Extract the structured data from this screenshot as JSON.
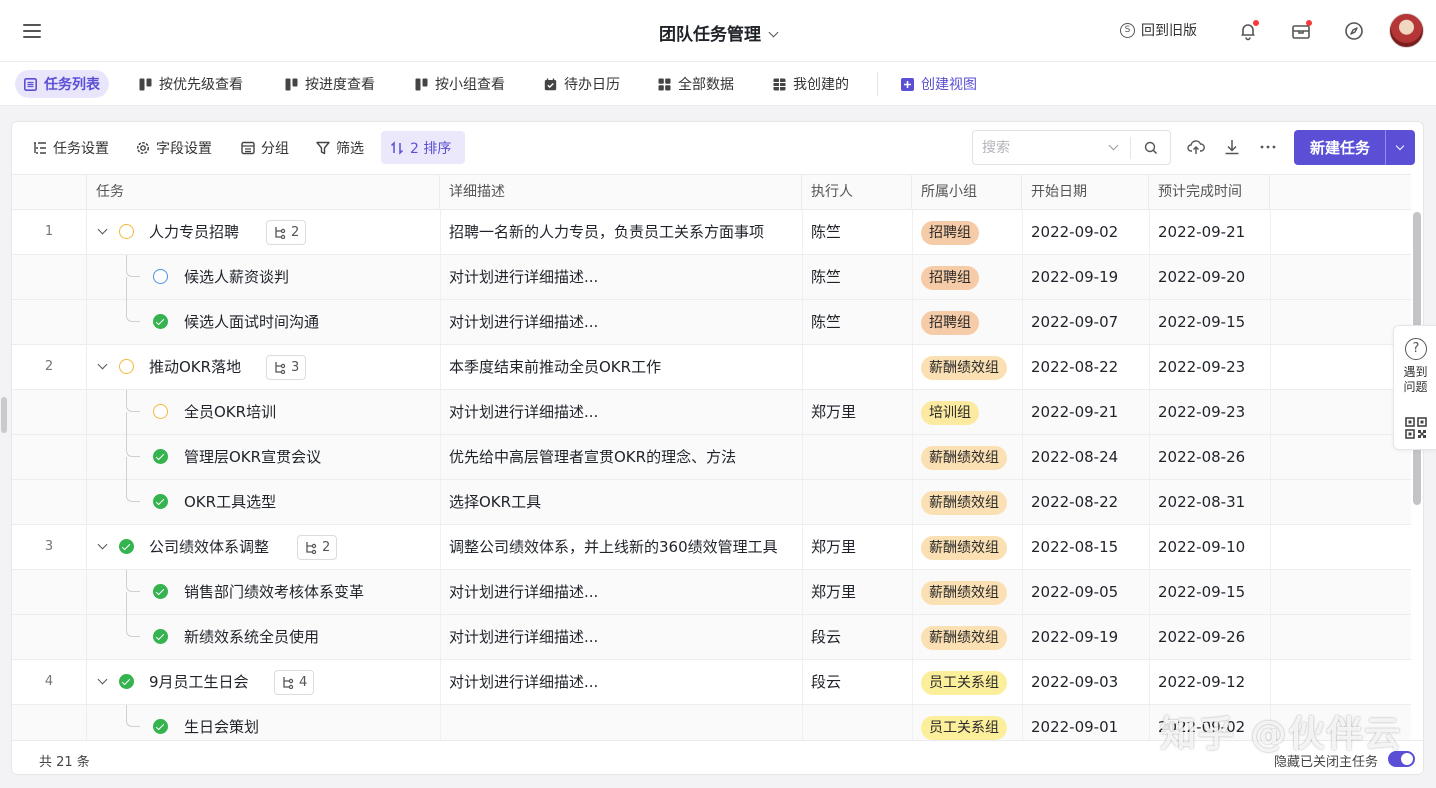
{
  "header": {
    "title": "团队任务管理",
    "back_old": "回到旧版"
  },
  "views": [
    {
      "label": "任务列表"
    },
    {
      "label": "按优先级查看"
    },
    {
      "label": "按进度查看"
    },
    {
      "label": "按小组查看"
    },
    {
      "label": "待办日历"
    },
    {
      "label": "全部数据"
    },
    {
      "label": "我创建的"
    },
    {
      "label": "创建视图"
    }
  ],
  "toolbar": {
    "task_settings": "任务设置",
    "field_settings": "字段设置",
    "group": "分组",
    "filter": "筛选",
    "sort": "2 排序",
    "search_placeholder": "搜索",
    "new_task": "新建任务"
  },
  "columns": [
    "任务",
    "详细描述",
    "执行人",
    "所属小组",
    "开始日期",
    "预计完成时间"
  ],
  "rows": [
    {
      "num": "1",
      "name": "人力专员招聘",
      "sub": "2",
      "desc": "招聘一名新的人力专员，负责员工关系方面事项",
      "owner": "陈竺",
      "group": "招聘组",
      "start": "2022-09-02",
      "end": "2022-09-21"
    },
    {
      "name": "候选人薪资谈判",
      "desc": "对计划进行详细描述...",
      "owner": "陈竺",
      "group": "招聘组",
      "start": "2022-09-19",
      "end": "2022-09-20"
    },
    {
      "name": "候选人面试时间沟通",
      "desc": "对计划进行详细描述...",
      "owner": "陈竺",
      "group": "招聘组",
      "start": "2022-09-07",
      "end": "2022-09-15"
    },
    {
      "num": "2",
      "name": "推动OKR落地",
      "sub": "3",
      "desc": "本季度结束前推动全员OKR工作",
      "owner": "",
      "group": "薪酬绩效组",
      "start": "2022-08-22",
      "end": "2022-09-23"
    },
    {
      "name": "全员OKR培训",
      "desc": "对计划进行详细描述...",
      "owner": "郑万里",
      "group": "培训组",
      "start": "2022-09-21",
      "end": "2022-09-23"
    },
    {
      "name": "管理层OKR宣贯会议",
      "desc": "优先给中高层管理者宣贯OKR的理念、方法",
      "owner": "",
      "group": "薪酬绩效组",
      "start": "2022-08-24",
      "end": "2022-08-26"
    },
    {
      "name": "OKR工具选型",
      "desc": "选择OKR工具",
      "owner": "",
      "group": "薪酬绩效组",
      "start": "2022-08-22",
      "end": "2022-08-31"
    },
    {
      "num": "3",
      "name": "公司绩效体系调整",
      "sub": "2",
      "desc": "调整公司绩效体系，并上线新的360绩效管理工具",
      "owner": "郑万里",
      "group": "薪酬绩效组",
      "start": "2022-08-15",
      "end": "2022-09-10"
    },
    {
      "name": "销售部门绩效考核体系变革",
      "desc": "对计划进行详细描述...",
      "owner": "郑万里",
      "group": "薪酬绩效组",
      "start": "2022-09-05",
      "end": "2022-09-15"
    },
    {
      "name": "新绩效系统全员使用",
      "desc": "对计划进行详细描述...",
      "owner": "段云",
      "group": "薪酬绩效组",
      "start": "2022-09-19",
      "end": "2022-09-26"
    },
    {
      "num": "4",
      "name": "9月员工生日会",
      "sub": "4",
      "desc": "对计划进行详细描述...",
      "owner": "段云",
      "group": "员工关系组",
      "start": "2022-09-03",
      "end": "2022-09-12"
    },
    {
      "name": "生日会策划",
      "desc": "",
      "owner": "",
      "group": "员工关系组",
      "start": "2022-09-01",
      "end": "2022-09-02"
    }
  ],
  "footer": {
    "total": "共 21 条",
    "hide_closed": "隐藏已关闭主任务"
  },
  "help": {
    "text_line1": "遇到",
    "text_line2": "问题"
  },
  "watermark": "知乎 @伙伴云",
  "colors": {
    "accent": "#5b4fd6",
    "tag_recruit": "#f6cba7",
    "tag_pay": "#fbe0b4",
    "tag_train": "#fbeaa0",
    "tag_relation": "#fcef9c",
    "done": "#34b34f",
    "todo": "#f2b93b",
    "pending_blue": "#4a90e2"
  }
}
